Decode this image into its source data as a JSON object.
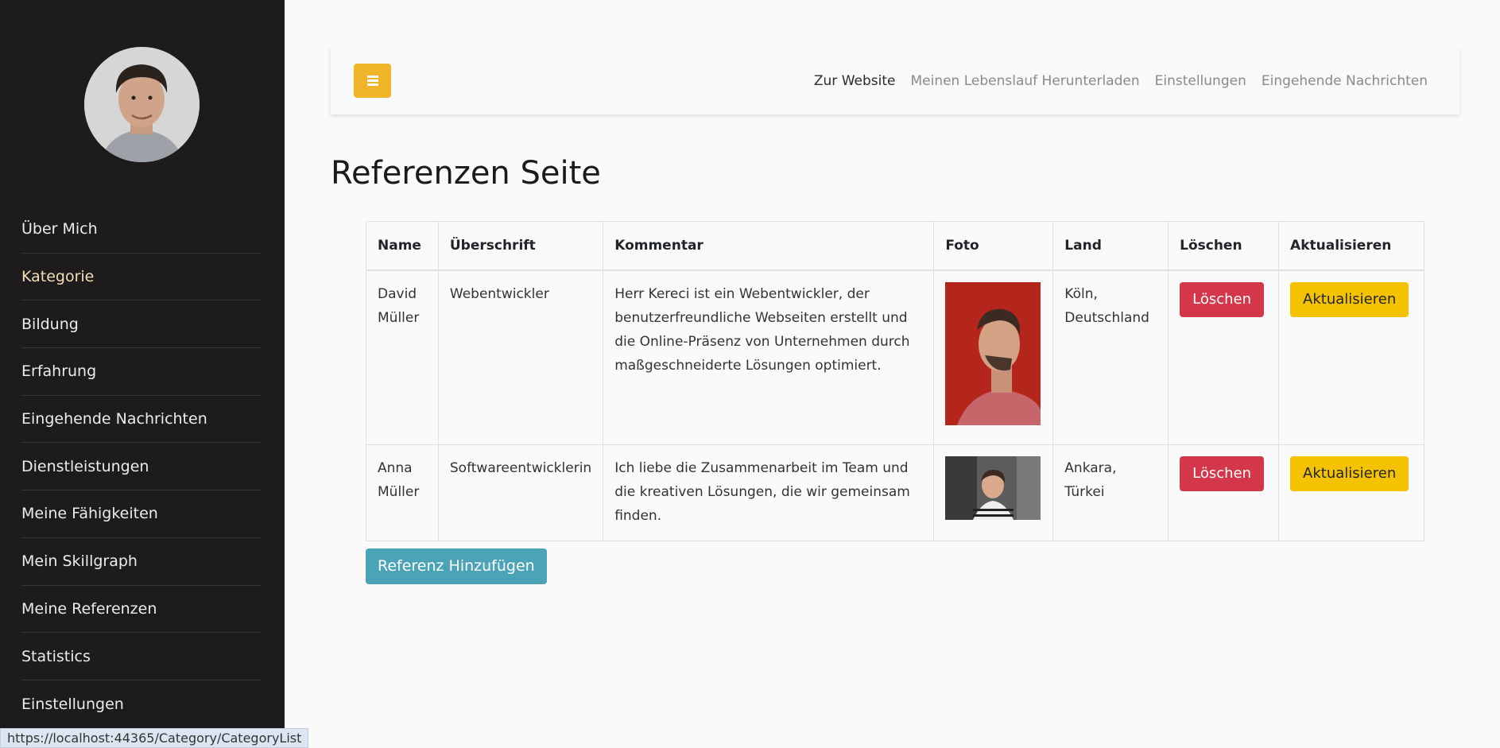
{
  "sidebar": {
    "avatar_alt": "",
    "items": [
      {
        "label": "Über Mich"
      },
      {
        "label": "Kategorie"
      },
      {
        "label": "Bildung"
      },
      {
        "label": "Erfahrung"
      },
      {
        "label": "Eingehende Nachrichten"
      },
      {
        "label": "Dienstleistungen"
      },
      {
        "label": "Meine Fähigkeiten"
      },
      {
        "label": "Mein Skillgraph"
      },
      {
        "label": "Meine Referenzen"
      },
      {
        "label": "Statistics"
      },
      {
        "label": "Einstellungen"
      }
    ],
    "hover_index": 1
  },
  "topbar": {
    "links": [
      {
        "label": "Zur Website"
      },
      {
        "label": "Meinen Lebenslauf Herunterladen"
      },
      {
        "label": "Einstellungen"
      },
      {
        "label": "Eingehende Nachrichten"
      }
    ]
  },
  "page": {
    "title": "Referenzen Seite"
  },
  "table": {
    "headers": [
      "Name",
      "Überschrift",
      "Kommentar",
      "Foto",
      "Land",
      "Löschen",
      "Aktualisieren"
    ],
    "rows": [
      {
        "name": "David Müller",
        "title": "Webentwickler",
        "comment": "Herr Kereci ist ein Webentwickler, der benutzerfreundliche Webseiten erstellt und die Online-Präsenz von Unternehmen durch maßgeschneiderte Lösungen optimiert.",
        "land": "Köln, Deutschland",
        "delete_label": "Löschen",
        "update_label": "Aktualisieren"
      },
      {
        "name": "Anna Müller",
        "title": "Softwareentwicklerin",
        "comment": "Ich liebe die Zusammenarbeit im Team und die kreativen Lösungen, die wir gemeinsam finden.",
        "land": "Ankara, Türkei",
        "delete_label": "Löschen",
        "update_label": "Aktualisieren"
      }
    ]
  },
  "add_button": {
    "label": "Referenz Hinzufügen"
  },
  "statusbar": {
    "url": "https://localhost:44365/Category/CategoryList"
  },
  "colors": {
    "sidebar_bg": "#1d1b1b",
    "accent_yellow": "#f0b429",
    "danger": "#d4374a",
    "warning": "#f5c200",
    "info": "#4ba3b7"
  }
}
